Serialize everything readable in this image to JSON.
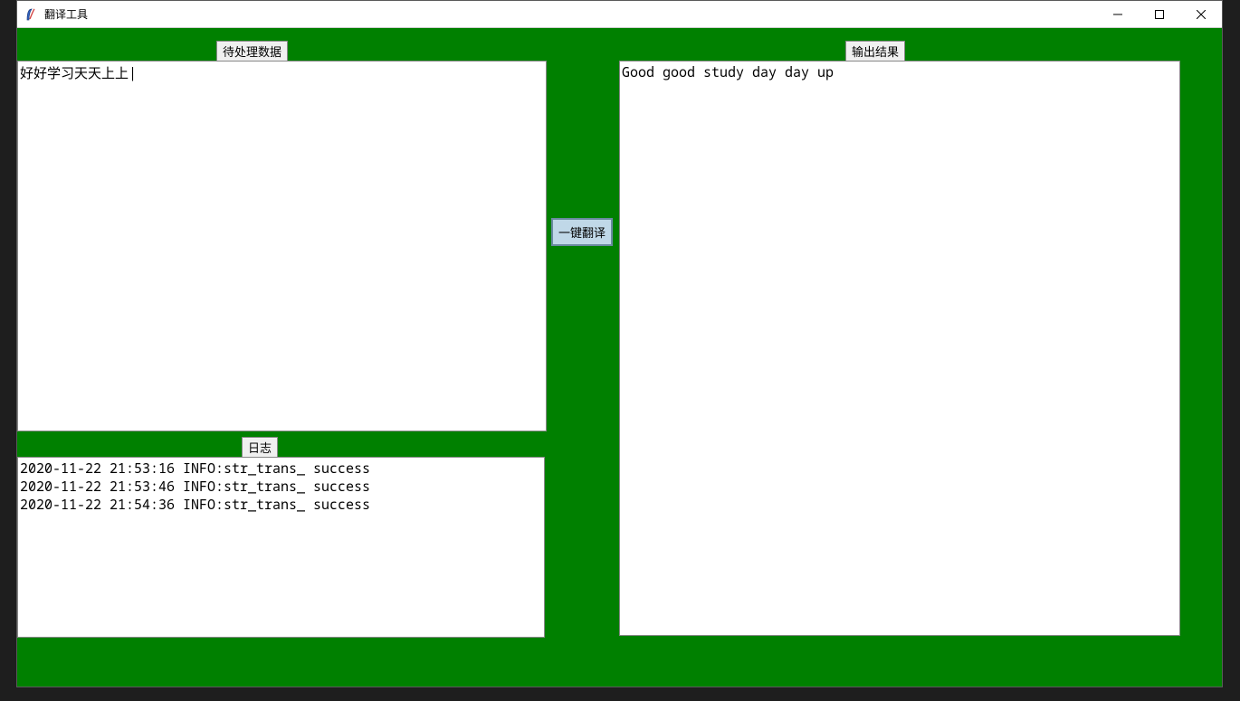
{
  "window": {
    "title": "翻译工具"
  },
  "labels": {
    "input": "待处理数据",
    "output": "输出结果",
    "log": "日志"
  },
  "button": {
    "translate": "一键翻译"
  },
  "input": {
    "value": "好好学习天天上上|"
  },
  "output": {
    "value": "Good good study day day up"
  },
  "log": {
    "lines": [
      "2020-11-22 21:53:16 INFO:str_trans_ success",
      "2020-11-22 21:53:46 INFO:str_trans_ success",
      "2020-11-22 21:54:36 INFO:str_trans_ success"
    ]
  }
}
